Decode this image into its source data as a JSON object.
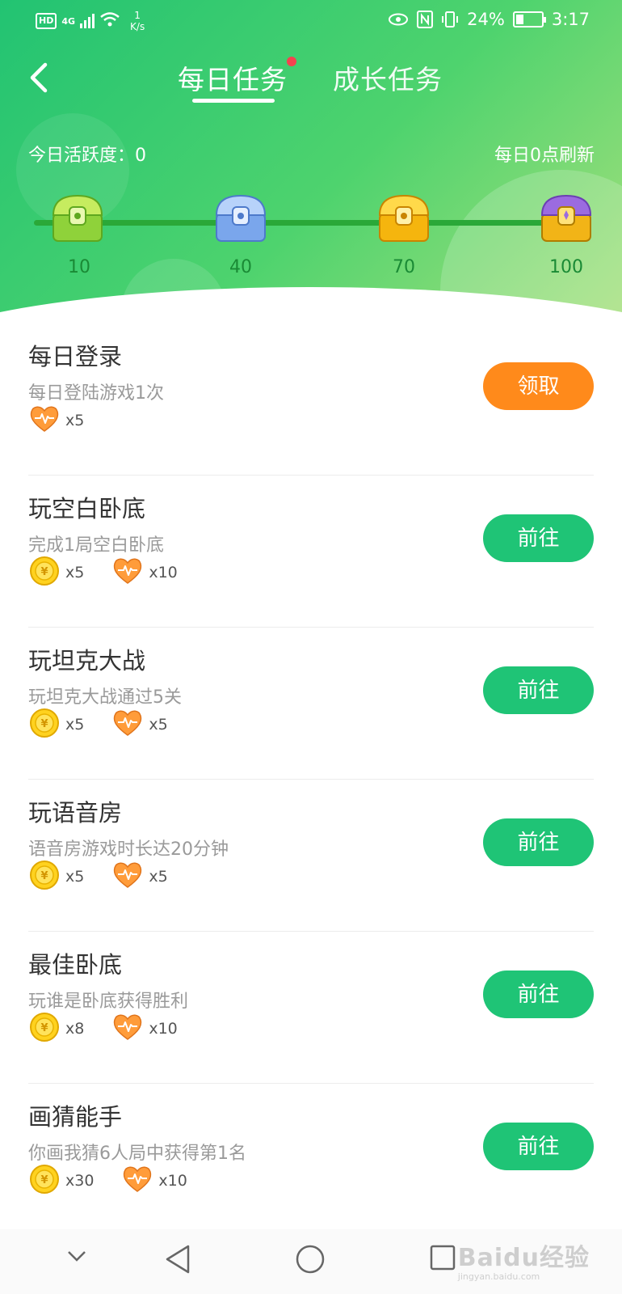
{
  "status_bar": {
    "hd": "HD",
    "network": "4G",
    "speed_top": "1",
    "speed_bottom": "K/s",
    "battery": "24%",
    "time": "3:17"
  },
  "tabs": [
    {
      "label": "每日任务",
      "active": true
    },
    {
      "label": "成长任务",
      "active": false
    }
  ],
  "activity_label": "今日活跃度：0",
  "refresh_label": "每日0点刷新",
  "milestones": [
    "10",
    "40",
    "70",
    "100"
  ],
  "tasks": [
    {
      "title": "每日登录",
      "desc": "每日登陆游戏1次",
      "rewards": [
        {
          "icon": "heart-icon",
          "amount": "x5"
        }
      ],
      "button": "领取",
      "button_type": "claim"
    },
    {
      "title": "玩空白卧底",
      "desc": "完成1局空白卧底",
      "rewards": [
        {
          "icon": "coin-icon",
          "amount": "x5"
        },
        {
          "icon": "heart-icon",
          "amount": "x10"
        }
      ],
      "button": "前往",
      "button_type": "go"
    },
    {
      "title": "玩坦克大战",
      "desc": "玩坦克大战通过5关",
      "rewards": [
        {
          "icon": "coin-icon",
          "amount": "x5"
        },
        {
          "icon": "heart-icon",
          "amount": "x5"
        }
      ],
      "button": "前往",
      "button_type": "go"
    },
    {
      "title": "玩语音房",
      "desc": "语音房游戏时长达20分钟",
      "rewards": [
        {
          "icon": "coin-icon",
          "amount": "x5"
        },
        {
          "icon": "heart-icon",
          "amount": "x5"
        }
      ],
      "button": "前往",
      "button_type": "go"
    },
    {
      "title": "最佳卧底",
      "desc": "玩谁是卧底获得胜利",
      "rewards": [
        {
          "icon": "coin-icon",
          "amount": "x8"
        },
        {
          "icon": "heart-icon",
          "amount": "x10"
        }
      ],
      "button": "前往",
      "button_type": "go"
    },
    {
      "title": "画猜能手",
      "desc": "你画我猜6人局中获得第1名",
      "rewards": [
        {
          "icon": "coin-icon",
          "amount": "x30"
        },
        {
          "icon": "heart-icon",
          "amount": "x10"
        }
      ],
      "button": "前往",
      "button_type": "go"
    }
  ],
  "watermark": {
    "main": "Baidu经验",
    "sub": "jingyan.baidu.com"
  },
  "colors": {
    "accent_green": "#1fc476",
    "claim_orange": "#ff8a1b",
    "badge_red": "#f5424f"
  }
}
